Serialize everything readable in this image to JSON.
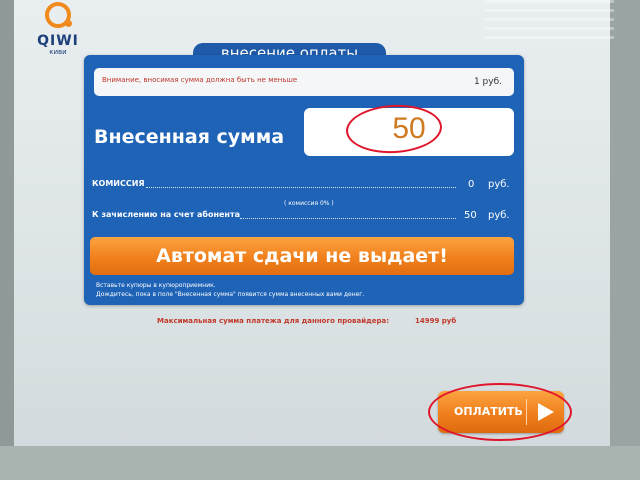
{
  "brand": {
    "name": "QIWI",
    "subtitle": "киви",
    "color": "#f08a1c"
  },
  "header": {
    "title": "внесение оплаты"
  },
  "warning": {
    "text": "Внимание, вносимая сумма должна быть не меньше",
    "min_value": "1 руб."
  },
  "amount": {
    "label": "Внесенная сумма",
    "value": "50"
  },
  "commission": {
    "label": "КОМИССИЯ",
    "value": "0",
    "unit": "руб.",
    "note": "( комиссия 0% )"
  },
  "credit": {
    "label": "К зачислению на счет абонента",
    "value": "50",
    "unit": "руб."
  },
  "change_notice": {
    "label": "Автомат сдачи не выдает!"
  },
  "hints": [
    "Вставьте купюры в купюроприемник.",
    "Дождитесь, пока в поле \"Внесенная сумма\" появится сумма внесенных вами денег."
  ],
  "limit": {
    "label": "Максимальная сумма платежа для данного провайдера:",
    "value": "14999 руб"
  },
  "pay_button": {
    "label": "ОПЛАТИТЬ"
  },
  "colors": {
    "panel": "#1e63b6",
    "accent": "#f08a1c",
    "annotation": "#e0152a"
  }
}
